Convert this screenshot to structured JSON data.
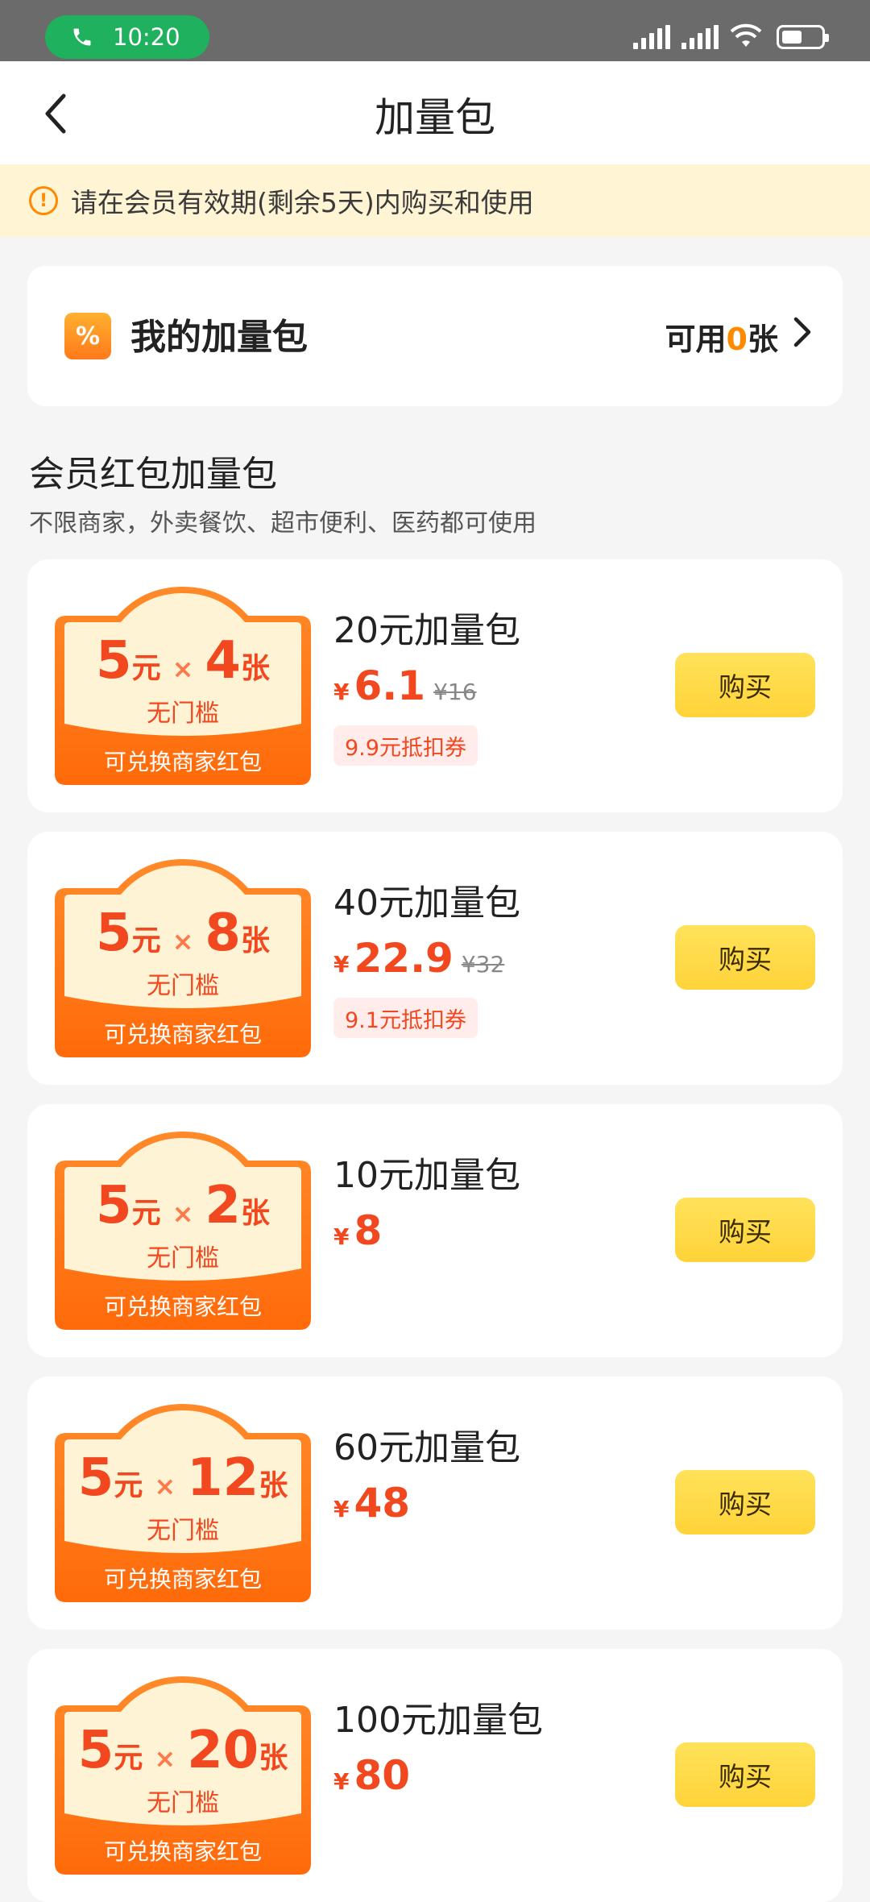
{
  "status_bar": {
    "time": "10:20"
  },
  "header": {
    "title": "加量包"
  },
  "notice": {
    "text": "请在会员有效期(剩余5天)内购买和使用"
  },
  "my_package": {
    "title": "我的加量包",
    "available_prefix": "可用",
    "available_count": "0",
    "available_suffix": "张"
  },
  "section": {
    "title": "会员红包加量包",
    "subtitle": "不限商家，外卖餐饮、超市便利、医药都可使用"
  },
  "packages": [
    {
      "coupon_value": "5",
      "coupon_unit": "元",
      "times": "×",
      "count": "4",
      "count_unit": "张",
      "no_threshold": "无门槛",
      "exchange": "可兑换商家红包",
      "name": "20元加量包",
      "yen": "¥",
      "price": "6.1",
      "original": "¥16",
      "discount": "9.9元抵扣券",
      "buy": "购买"
    },
    {
      "coupon_value": "5",
      "coupon_unit": "元",
      "times": "×",
      "count": "8",
      "count_unit": "张",
      "no_threshold": "无门槛",
      "exchange": "可兑换商家红包",
      "name": "40元加量包",
      "yen": "¥",
      "price": "22.9",
      "original": "¥32",
      "discount": "9.1元抵扣券",
      "buy": "购买"
    },
    {
      "coupon_value": "5",
      "coupon_unit": "元",
      "times": "×",
      "count": "2",
      "count_unit": "张",
      "no_threshold": "无门槛",
      "exchange": "可兑换商家红包",
      "name": "10元加量包",
      "yen": "¥",
      "price": "8",
      "buy": "购买"
    },
    {
      "coupon_value": "5",
      "coupon_unit": "元",
      "times": "×",
      "count": "12",
      "count_unit": "张",
      "no_threshold": "无门槛",
      "exchange": "可兑换商家红包",
      "name": "60元加量包",
      "yen": "¥",
      "price": "48",
      "buy": "购买"
    },
    {
      "coupon_value": "5",
      "coupon_unit": "元",
      "times": "×",
      "count": "20",
      "count_unit": "张",
      "no_threshold": "无门槛",
      "exchange": "可兑换商家红包",
      "name": "100元加量包",
      "yen": "¥",
      "price": "80",
      "buy": "购买"
    }
  ],
  "colors": {
    "accent": "#f1481f",
    "orange": "#ff8a00",
    "button": "#ffd339",
    "notice_bg": "#fff4d4"
  }
}
